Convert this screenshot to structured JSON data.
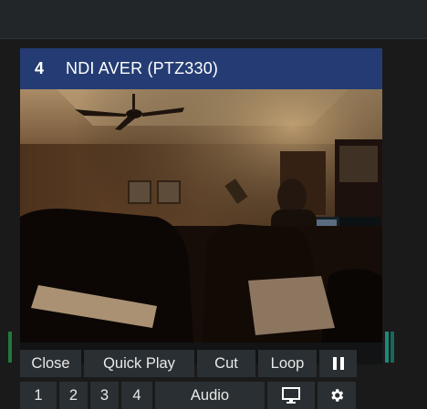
{
  "channel": {
    "number": "4",
    "name": "NDI AVER (PTZ330)"
  },
  "controls": {
    "row1": [
      {
        "label": "Close",
        "name": "close-button"
      },
      {
        "label": "Quick Play",
        "name": "quick-play-button"
      },
      {
        "label": "Cut",
        "name": "cut-button"
      },
      {
        "label": "Loop",
        "name": "loop-button"
      },
      {
        "label": "II",
        "name": "pause-button"
      }
    ],
    "row2": [
      {
        "label": "1",
        "name": "preset-1-button"
      },
      {
        "label": "2",
        "name": "preset-2-button"
      },
      {
        "label": "3",
        "name": "preset-3-button"
      },
      {
        "label": "4",
        "name": "preset-4-button"
      },
      {
        "label": "Audio",
        "name": "audio-button"
      }
    ]
  },
  "icons": {
    "monitor": "monitor-icon",
    "settings": "gear-icon",
    "pause": "pause-icon"
  },
  "colors": {
    "header": "#243c73",
    "button": "#2a2f33",
    "tally_left": "#1f7a3a",
    "tally_right": "#1f8a7a"
  }
}
